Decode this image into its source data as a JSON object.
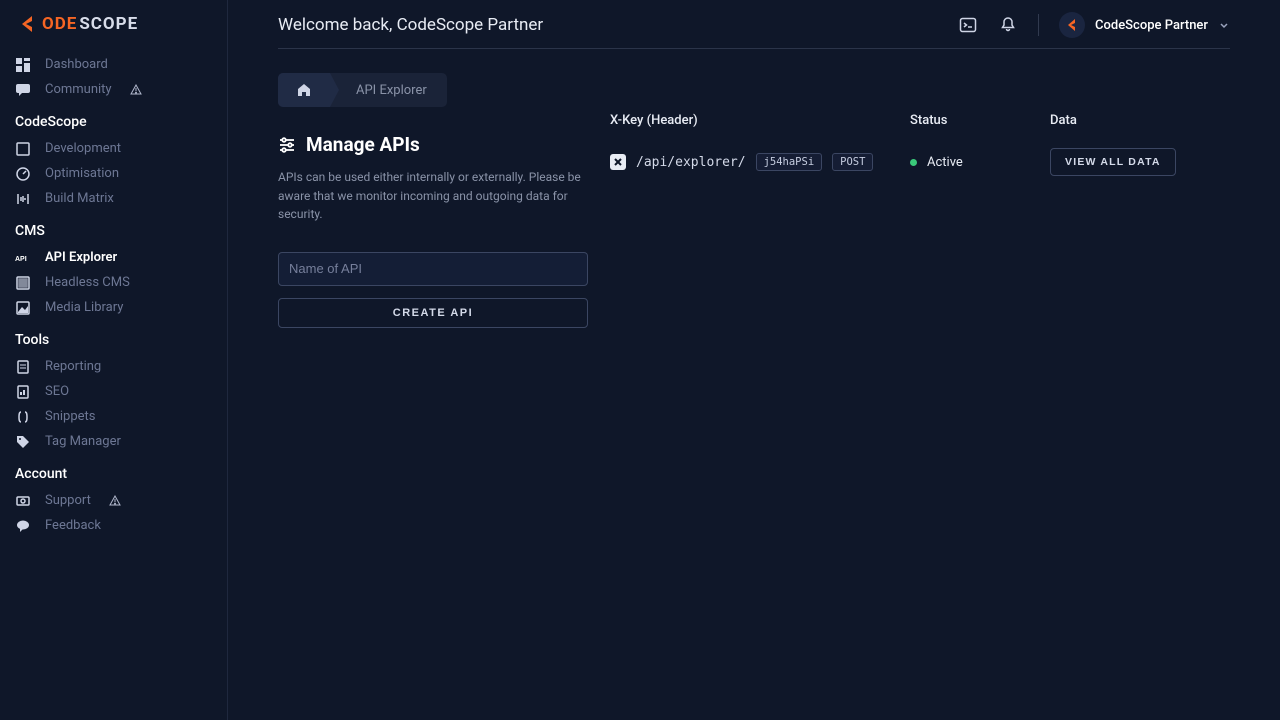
{
  "brand": {
    "p1": "ODE",
    "p2": "SCOPE"
  },
  "header": {
    "greeting": "Welcome back, CodeScope Partner",
    "username": "CodeScope Partner"
  },
  "breadcrumb": {
    "page": "API Explorer"
  },
  "page": {
    "title": "Manage APIs",
    "description": "APIs can be used either internally or externally. Please be aware that we monitor incoming and outgoing data for security.",
    "api_name_placeholder": "Name of API",
    "create_btn": "CREATE API"
  },
  "table": {
    "headers": {
      "key": "X-Key (Header)",
      "status": "Status",
      "data": "Data"
    },
    "row": {
      "path": "/api/explorer/",
      "xkey": "j54haPSi",
      "method": "POST",
      "status": "Active",
      "data_btn": "VIEW ALL DATA"
    }
  },
  "sidebar": {
    "top": [
      {
        "label": "Dashboard",
        "icon": "dashboard"
      },
      {
        "label": "Community",
        "icon": "chat",
        "warn": true
      }
    ],
    "groups": [
      {
        "title": "CodeScope",
        "items": [
          {
            "label": "Development",
            "icon": "dev"
          },
          {
            "label": "Optimisation",
            "icon": "gauge"
          },
          {
            "label": "Build Matrix",
            "icon": "matrix"
          }
        ]
      },
      {
        "title": "CMS",
        "items": [
          {
            "label": "API Explorer",
            "icon": "api",
            "active": true
          },
          {
            "label": "Headless CMS",
            "icon": "headless"
          },
          {
            "label": "Media Library",
            "icon": "media"
          }
        ]
      },
      {
        "title": "Tools",
        "items": [
          {
            "label": "Reporting",
            "icon": "report"
          },
          {
            "label": "SEO",
            "icon": "seo"
          },
          {
            "label": "Snippets",
            "icon": "snippet"
          },
          {
            "label": "Tag Manager",
            "icon": "tag"
          }
        ]
      },
      {
        "title": "Account",
        "items": [
          {
            "label": "Support",
            "icon": "support",
            "warn": true
          },
          {
            "label": "Feedback",
            "icon": "feedback"
          }
        ]
      }
    ]
  }
}
